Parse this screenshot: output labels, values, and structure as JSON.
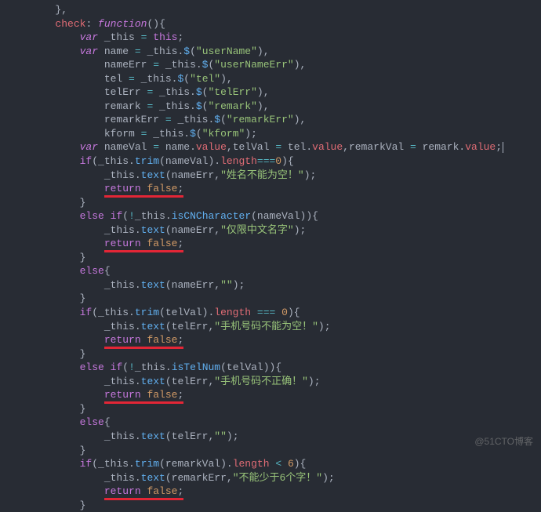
{
  "lines": [
    {
      "indent": "        ",
      "parts": [
        {
          "t": "},",
          "c": "punct"
        }
      ]
    },
    {
      "indent": "        ",
      "parts": [
        {
          "t": "check",
          "c": "prop"
        },
        {
          "t": ": ",
          "c": "punct"
        },
        {
          "t": "function",
          "c": "kw"
        },
        {
          "t": "(){",
          "c": "punct"
        }
      ]
    },
    {
      "indent": "            ",
      "parts": [
        {
          "t": "var",
          "c": "kw"
        },
        {
          "t": " _this ",
          "c": "var"
        },
        {
          "t": "=",
          "c": "op"
        },
        {
          "t": " ",
          "c": "var"
        },
        {
          "t": "this",
          "c": "kw2"
        },
        {
          "t": ";",
          "c": "punct"
        }
      ]
    },
    {
      "indent": "            ",
      "parts": [
        {
          "t": "var",
          "c": "kw"
        },
        {
          "t": " name ",
          "c": "var"
        },
        {
          "t": "=",
          "c": "op"
        },
        {
          "t": " _this.",
          "c": "var"
        },
        {
          "t": "$",
          "c": "fn"
        },
        {
          "t": "(",
          "c": "punct"
        },
        {
          "t": "\"userName\"",
          "c": "str"
        },
        {
          "t": "),",
          "c": "punct"
        }
      ]
    },
    {
      "indent": "                ",
      "parts": [
        {
          "t": "nameErr ",
          "c": "var"
        },
        {
          "t": "=",
          "c": "op"
        },
        {
          "t": " _this.",
          "c": "var"
        },
        {
          "t": "$",
          "c": "fn"
        },
        {
          "t": "(",
          "c": "punct"
        },
        {
          "t": "\"userNameErr\"",
          "c": "str"
        },
        {
          "t": "),",
          "c": "punct"
        }
      ]
    },
    {
      "indent": "                ",
      "parts": [
        {
          "t": "tel ",
          "c": "var"
        },
        {
          "t": "=",
          "c": "op"
        },
        {
          "t": " _this.",
          "c": "var"
        },
        {
          "t": "$",
          "c": "fn"
        },
        {
          "t": "(",
          "c": "punct"
        },
        {
          "t": "\"tel\"",
          "c": "str"
        },
        {
          "t": "),",
          "c": "punct"
        }
      ]
    },
    {
      "indent": "                ",
      "parts": [
        {
          "t": "telErr ",
          "c": "var"
        },
        {
          "t": "=",
          "c": "op"
        },
        {
          "t": " _this.",
          "c": "var"
        },
        {
          "t": "$",
          "c": "fn"
        },
        {
          "t": "(",
          "c": "punct"
        },
        {
          "t": "\"telErr\"",
          "c": "str"
        },
        {
          "t": "),",
          "c": "punct"
        }
      ]
    },
    {
      "indent": "                ",
      "parts": [
        {
          "t": "remark ",
          "c": "var"
        },
        {
          "t": "=",
          "c": "op"
        },
        {
          "t": " _this.",
          "c": "var"
        },
        {
          "t": "$",
          "c": "fn"
        },
        {
          "t": "(",
          "c": "punct"
        },
        {
          "t": "\"remark\"",
          "c": "str"
        },
        {
          "t": "),",
          "c": "punct"
        }
      ]
    },
    {
      "indent": "                ",
      "parts": [
        {
          "t": "remarkErr ",
          "c": "var"
        },
        {
          "t": "=",
          "c": "op"
        },
        {
          "t": " _this.",
          "c": "var"
        },
        {
          "t": "$",
          "c": "fn"
        },
        {
          "t": "(",
          "c": "punct"
        },
        {
          "t": "\"remarkErr\"",
          "c": "str"
        },
        {
          "t": "),",
          "c": "punct"
        }
      ]
    },
    {
      "indent": "                ",
      "parts": [
        {
          "t": "kform ",
          "c": "var"
        },
        {
          "t": "=",
          "c": "op"
        },
        {
          "t": " _this.",
          "c": "var"
        },
        {
          "t": "$",
          "c": "fn"
        },
        {
          "t": "(",
          "c": "punct"
        },
        {
          "t": "\"kform\"",
          "c": "str"
        },
        {
          "t": ");",
          "c": "punct"
        }
      ]
    },
    {
      "indent": "            ",
      "parts": [
        {
          "t": "var",
          "c": "kw"
        },
        {
          "t": " nameVal ",
          "c": "var"
        },
        {
          "t": "=",
          "c": "op"
        },
        {
          "t": " name.",
          "c": "var"
        },
        {
          "t": "value",
          "c": "prop"
        },
        {
          "t": ",telVal ",
          "c": "var"
        },
        {
          "t": "=",
          "c": "op"
        },
        {
          "t": " tel.",
          "c": "var"
        },
        {
          "t": "value",
          "c": "prop"
        },
        {
          "t": ",remarkVal ",
          "c": "var"
        },
        {
          "t": "=",
          "c": "op"
        },
        {
          "t": " remark.",
          "c": "var"
        },
        {
          "t": "value",
          "c": "prop"
        },
        {
          "t": ";",
          "c": "punct"
        }
      ],
      "cursor": true
    },
    {
      "indent": "            ",
      "parts": [
        {
          "t": "if",
          "c": "kw2"
        },
        {
          "t": "(_this.",
          "c": "var"
        },
        {
          "t": "trim",
          "c": "fn"
        },
        {
          "t": "(nameVal).",
          "c": "var"
        },
        {
          "t": "length",
          "c": "prop"
        },
        {
          "t": "===",
          "c": "op"
        },
        {
          "t": "0",
          "c": "num"
        },
        {
          "t": "){",
          "c": "punct"
        }
      ]
    },
    {
      "indent": "                ",
      "parts": [
        {
          "t": "_this.",
          "c": "var"
        },
        {
          "t": "text",
          "c": "fn"
        },
        {
          "t": "(nameErr,",
          "c": "var"
        },
        {
          "t": "\"姓名不能为空！\"",
          "c": "str"
        },
        {
          "t": ");",
          "c": "punct"
        }
      ]
    },
    {
      "indent": "                ",
      "parts": [
        {
          "t": "return",
          "c": "kw2",
          "u": true
        },
        {
          "t": " ",
          "c": "var",
          "u": true
        },
        {
          "t": "false",
          "c": "num",
          "u": true
        },
        {
          "t": ";",
          "c": "punct",
          "u": true
        }
      ]
    },
    {
      "indent": "            ",
      "parts": [
        {
          "t": "}",
          "c": "punct"
        }
      ]
    },
    {
      "indent": "            ",
      "parts": [
        {
          "t": "else",
          "c": "kw2"
        },
        {
          "t": " ",
          "c": "var"
        },
        {
          "t": "if",
          "c": "kw2"
        },
        {
          "t": "(",
          "c": "punct"
        },
        {
          "t": "!",
          "c": "op"
        },
        {
          "t": "_this.",
          "c": "var"
        },
        {
          "t": "isCNCharacter",
          "c": "fn"
        },
        {
          "t": "(nameVal)){",
          "c": "var"
        }
      ]
    },
    {
      "indent": "                ",
      "parts": [
        {
          "t": "_this.",
          "c": "var"
        },
        {
          "t": "text",
          "c": "fn"
        },
        {
          "t": "(nameErr,",
          "c": "var"
        },
        {
          "t": "\"仅限中文名字\"",
          "c": "str"
        },
        {
          "t": ");",
          "c": "punct"
        }
      ]
    },
    {
      "indent": "                ",
      "parts": [
        {
          "t": "return",
          "c": "kw2",
          "u": true
        },
        {
          "t": " ",
          "c": "var",
          "u": true
        },
        {
          "t": "false",
          "c": "num",
          "u": true
        },
        {
          "t": ";",
          "c": "punct",
          "u": true
        }
      ]
    },
    {
      "indent": "            ",
      "parts": [
        {
          "t": "}",
          "c": "punct"
        }
      ]
    },
    {
      "indent": "            ",
      "parts": [
        {
          "t": "else",
          "c": "kw2"
        },
        {
          "t": "{",
          "c": "punct"
        }
      ]
    },
    {
      "indent": "                ",
      "parts": [
        {
          "t": "_this.",
          "c": "var"
        },
        {
          "t": "text",
          "c": "fn"
        },
        {
          "t": "(nameErr,",
          "c": "var"
        },
        {
          "t": "\"\"",
          "c": "str"
        },
        {
          "t": ");",
          "c": "punct"
        }
      ]
    },
    {
      "indent": "            ",
      "parts": [
        {
          "t": "}",
          "c": "punct"
        }
      ]
    },
    {
      "indent": "            ",
      "parts": [
        {
          "t": "if",
          "c": "kw2"
        },
        {
          "t": "(_this.",
          "c": "var"
        },
        {
          "t": "trim",
          "c": "fn"
        },
        {
          "t": "(telVal).",
          "c": "var"
        },
        {
          "t": "length",
          "c": "prop"
        },
        {
          "t": " ",
          "c": "var"
        },
        {
          "t": "===",
          "c": "op"
        },
        {
          "t": " ",
          "c": "var"
        },
        {
          "t": "0",
          "c": "num"
        },
        {
          "t": "){",
          "c": "punct"
        }
      ]
    },
    {
      "indent": "                ",
      "parts": [
        {
          "t": "_this.",
          "c": "var"
        },
        {
          "t": "text",
          "c": "fn"
        },
        {
          "t": "(telErr,",
          "c": "var"
        },
        {
          "t": "\"手机号码不能为空！\"",
          "c": "str"
        },
        {
          "t": ");",
          "c": "punct"
        }
      ]
    },
    {
      "indent": "                ",
      "parts": [
        {
          "t": "return",
          "c": "kw2",
          "u": true
        },
        {
          "t": " ",
          "c": "var",
          "u": true
        },
        {
          "t": "false",
          "c": "num",
          "u": true
        },
        {
          "t": ";",
          "c": "punct",
          "u": true
        }
      ]
    },
    {
      "indent": "            ",
      "parts": [
        {
          "t": "}",
          "c": "punct"
        }
      ]
    },
    {
      "indent": "            ",
      "parts": [
        {
          "t": "else",
          "c": "kw2"
        },
        {
          "t": " ",
          "c": "var"
        },
        {
          "t": "if",
          "c": "kw2"
        },
        {
          "t": "(",
          "c": "punct"
        },
        {
          "t": "!",
          "c": "op"
        },
        {
          "t": "_this.",
          "c": "var"
        },
        {
          "t": "isTelNum",
          "c": "fn"
        },
        {
          "t": "(telVal)){",
          "c": "var"
        }
      ]
    },
    {
      "indent": "                ",
      "parts": [
        {
          "t": "_this.",
          "c": "var"
        },
        {
          "t": "text",
          "c": "fn"
        },
        {
          "t": "(telErr,",
          "c": "var"
        },
        {
          "t": "\"手机号码不正确！\"",
          "c": "str"
        },
        {
          "t": ");",
          "c": "punct"
        }
      ]
    },
    {
      "indent": "                ",
      "parts": [
        {
          "t": "return",
          "c": "kw2",
          "u": true
        },
        {
          "t": " ",
          "c": "var",
          "u": true
        },
        {
          "t": "false",
          "c": "num",
          "u": true
        },
        {
          "t": ";",
          "c": "punct",
          "u": true
        }
      ]
    },
    {
      "indent": "            ",
      "parts": [
        {
          "t": "}",
          "c": "punct"
        }
      ]
    },
    {
      "indent": "            ",
      "parts": [
        {
          "t": "else",
          "c": "kw2"
        },
        {
          "t": "{",
          "c": "punct"
        }
      ]
    },
    {
      "indent": "                ",
      "parts": [
        {
          "t": "_this.",
          "c": "var"
        },
        {
          "t": "text",
          "c": "fn"
        },
        {
          "t": "(telErr,",
          "c": "var"
        },
        {
          "t": "\"\"",
          "c": "str"
        },
        {
          "t": ");",
          "c": "punct"
        }
      ]
    },
    {
      "indent": "            ",
      "parts": [
        {
          "t": "}",
          "c": "punct"
        }
      ]
    },
    {
      "indent": "            ",
      "parts": [
        {
          "t": "if",
          "c": "kw2"
        },
        {
          "t": "(_this.",
          "c": "var"
        },
        {
          "t": "trim",
          "c": "fn"
        },
        {
          "t": "(remarkVal).",
          "c": "var"
        },
        {
          "t": "length",
          "c": "prop"
        },
        {
          "t": " ",
          "c": "var"
        },
        {
          "t": "<",
          "c": "op"
        },
        {
          "t": " ",
          "c": "var"
        },
        {
          "t": "6",
          "c": "num"
        },
        {
          "t": "){",
          "c": "punct"
        }
      ]
    },
    {
      "indent": "                ",
      "parts": [
        {
          "t": "_this.",
          "c": "var"
        },
        {
          "t": "text",
          "c": "fn"
        },
        {
          "t": "(remarkErr,",
          "c": "var"
        },
        {
          "t": "\"不能少于6个字！\"",
          "c": "str"
        },
        {
          "t": ");",
          "c": "punct"
        }
      ]
    },
    {
      "indent": "                ",
      "parts": [
        {
          "t": "return",
          "c": "kw2",
          "u": true
        },
        {
          "t": " ",
          "c": "var",
          "u": true
        },
        {
          "t": "false",
          "c": "num",
          "u": true
        },
        {
          "t": ";",
          "c": "punct",
          "u": true
        }
      ]
    },
    {
      "indent": "            ",
      "parts": [
        {
          "t": "}",
          "c": "punct"
        }
      ]
    }
  ],
  "watermark": "@51CTO博客"
}
